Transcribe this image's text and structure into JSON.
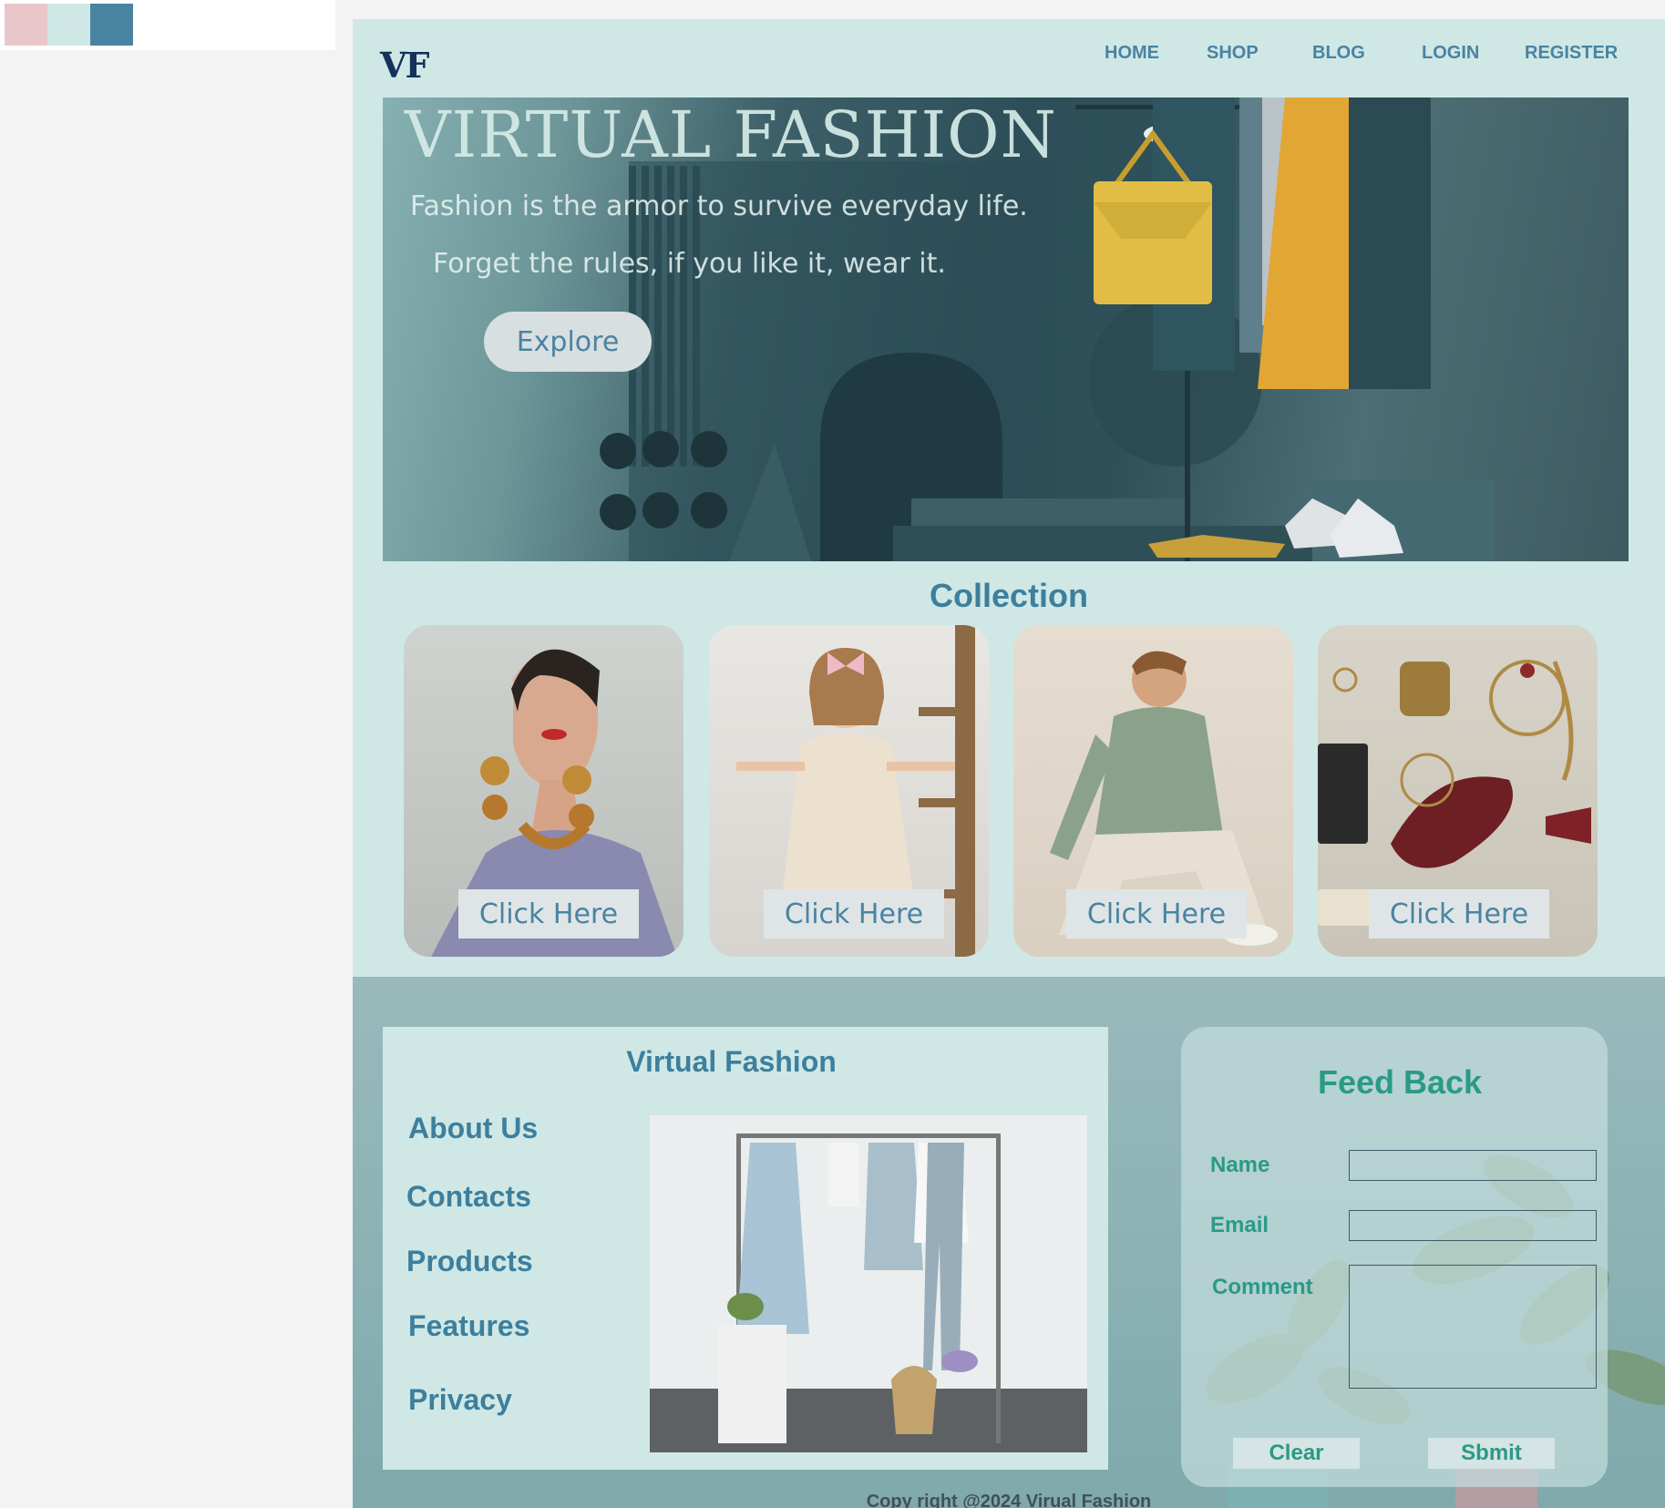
{
  "palette": [
    "#e9c6ca",
    "#cfe8e5",
    "#4a83a2"
  ],
  "nav": {
    "logo": "VF",
    "links": [
      "HOME",
      "SHOP",
      "BLOG",
      "LOGIN",
      "REGISTER"
    ]
  },
  "hero": {
    "title": "VIRTUAL FASHION",
    "tagline1": "Fashion is the armor to survive everyday life.",
    "tagline2": "Forget the rules, if you like it, wear it.",
    "button": "Explore"
  },
  "collection": {
    "title": "Collection",
    "cards": [
      {
        "subject": "woman-with-earrings",
        "button": "Click Here"
      },
      {
        "subject": "girl-in-dress",
        "button": "Click Here"
      },
      {
        "subject": "man-in-sweater",
        "button": "Click Here"
      },
      {
        "subject": "accessories",
        "button": "Click Here"
      }
    ]
  },
  "footer": {
    "info_title": "Virtual Fashion",
    "links": [
      "About Us",
      "Contacts",
      "Products",
      "Features",
      "Privacy"
    ],
    "feedback": {
      "title": "Feed Back",
      "name_label": "Name",
      "email_label": "Email",
      "comment_label": "Comment",
      "clear": "Clear",
      "submit": "Sbmit"
    },
    "copyright": "Copy right @2024 Virual Fashion"
  },
  "colors": {
    "accent": "#4a83a2",
    "bg": "#cfe8e5",
    "feedback": "#2a9a86"
  }
}
